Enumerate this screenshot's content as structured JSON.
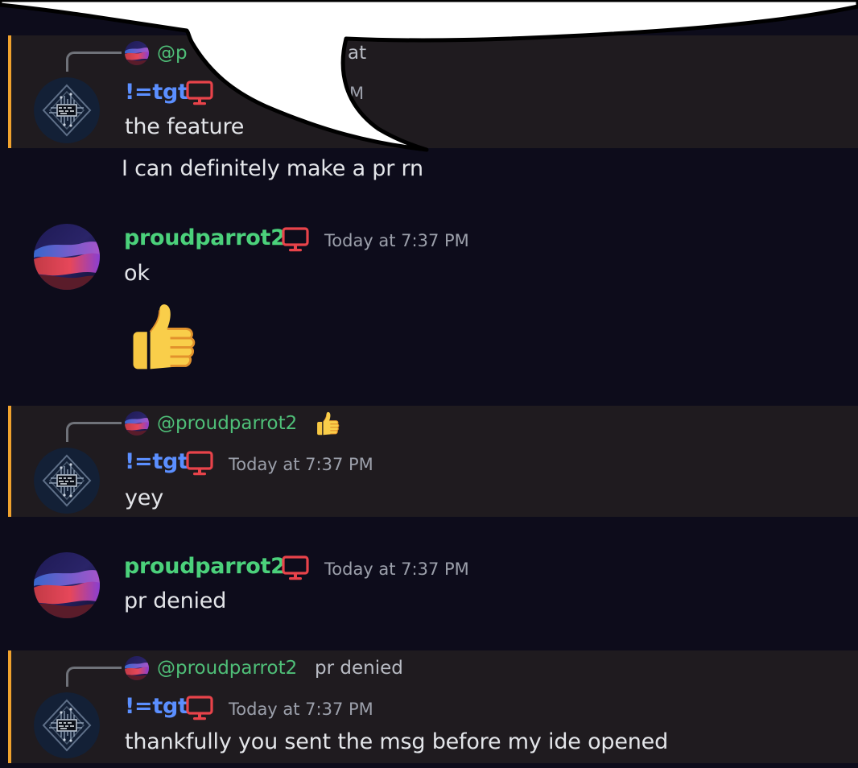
{
  "messages": [
    {
      "type": "reply",
      "reply_to": {
        "mention": "@p",
        "snippet": "at"
      },
      "author": "!=tgt",
      "timestamp": "M",
      "text": "the feature"
    },
    {
      "type": "continuation",
      "text": "I can definitely make a pr rn"
    },
    {
      "type": "message",
      "author": "proudparrot2",
      "timestamp": "Today at 7:37 PM",
      "text": "ok",
      "attachment_emoji": "thumbs-up-emoji"
    },
    {
      "type": "reply",
      "reply_to": {
        "mention": "@proudparrot2",
        "snippet_emoji": "thumbs-up-emoji"
      },
      "author": "!=tgt",
      "timestamp": "Today at 7:37 PM",
      "text": "yey"
    },
    {
      "type": "message",
      "author": "proudparrot2",
      "timestamp": "Today at 7:37 PM",
      "text": "pr denied"
    },
    {
      "type": "reply",
      "reply_to": {
        "mention": "@proudparrot2",
        "snippet": "pr denied"
      },
      "author": "!=tgt",
      "timestamp": "Today at 7:37 PM",
      "text": "thankfully you sent the msg before my ide opened"
    }
  ],
  "icons": {
    "device_badge": "monitor-icon",
    "reply_connector": "reply-arrow-icon"
  },
  "colors": {
    "background": "#0d0c1b",
    "mention_highlight_bg": "#1f1b1f",
    "mention_border": "#f0a22e",
    "tgt_name": "#5b8fff",
    "parrot_name": "#4bd17b",
    "mention_text": "#4fbf78",
    "timestamp": "#9ca0ab",
    "message_text": "#e3e5e9",
    "device_icon": "#e8434a"
  }
}
